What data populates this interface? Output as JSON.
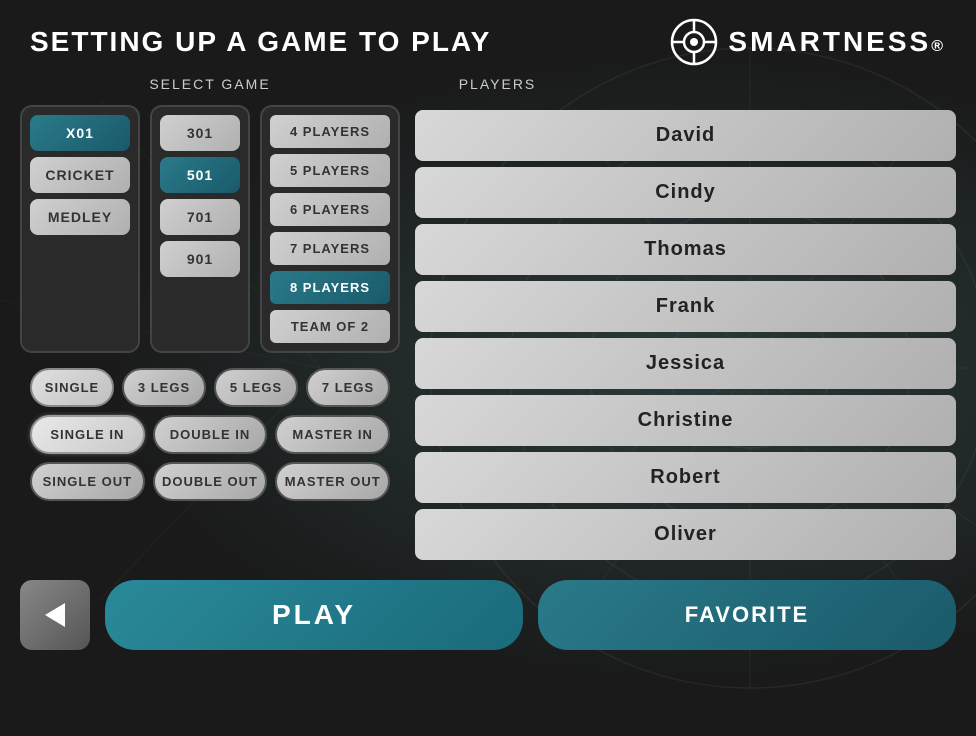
{
  "header": {
    "title": "SETTING UP A GAME TO PLAY",
    "logo_text": "SMARTNESS",
    "logo_reg": "®"
  },
  "select_game_label": "SELECT GAME",
  "players_label": "PLAYERS",
  "game_types": [
    {
      "label": "X01",
      "selected": true
    },
    {
      "label": "CRICKET",
      "selected": false
    },
    {
      "label": "MEDLEY",
      "selected": false
    }
  ],
  "game_scores": [
    {
      "label": "301",
      "selected": false
    },
    {
      "label": "501",
      "selected": true
    },
    {
      "label": "701",
      "selected": false
    },
    {
      "label": "901",
      "selected": false
    }
  ],
  "player_counts": [
    {
      "label": "4 PLAYERS",
      "selected": false
    },
    {
      "label": "5 PLAYERS",
      "selected": false
    },
    {
      "label": "6 PLAYERS",
      "selected": false
    },
    {
      "label": "7 PLAYERS",
      "selected": false
    },
    {
      "label": "8 PLAYERS",
      "selected": true
    },
    {
      "label": "TEAM OF 2",
      "selected": false
    }
  ],
  "options_row1": [
    {
      "label": "SINGLE",
      "selected": true
    },
    {
      "label": "3 LEGS",
      "selected": false
    },
    {
      "label": "5 LEGS",
      "selected": false
    },
    {
      "label": "7 LEGS",
      "selected": false
    }
  ],
  "options_row2": [
    {
      "label": "SINGLE IN",
      "selected": true
    },
    {
      "label": "DOUBLE IN",
      "selected": false
    },
    {
      "label": "MASTER IN",
      "selected": false
    }
  ],
  "options_row3": [
    {
      "label": "SINGLE OUT",
      "selected": false
    },
    {
      "label": "DOUBLE OUT",
      "selected": false
    },
    {
      "label": "MASTER OUT",
      "selected": false
    }
  ],
  "buttons": {
    "back_arrow": "◀",
    "play": "PLAY",
    "favorite": "FAVORITE"
  },
  "players": [
    {
      "name": "David"
    },
    {
      "name": "Cindy"
    },
    {
      "name": "Thomas"
    },
    {
      "name": "Frank"
    },
    {
      "name": "Jessica"
    },
    {
      "name": "Christine"
    },
    {
      "name": "Robert"
    },
    {
      "name": "Oliver"
    }
  ]
}
